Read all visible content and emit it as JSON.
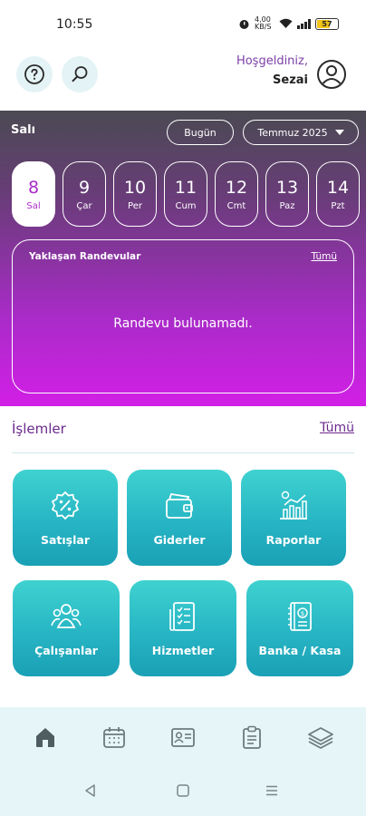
{
  "status": {
    "time": "10:55",
    "net": "4,00 KB/S",
    "battery": "57"
  },
  "header": {
    "welcome": "Hoşgeldiniz,",
    "user": "Sezai"
  },
  "hero": {
    "day_title": "Salı",
    "today_label": "Bugün",
    "month_label": "Temmuz 2025",
    "days": [
      {
        "num": "8",
        "name": "Sal",
        "active": true
      },
      {
        "num": "9",
        "name": "Çar"
      },
      {
        "num": "10",
        "name": "Per"
      },
      {
        "num": "11",
        "name": "Cum"
      },
      {
        "num": "12",
        "name": "Cmt"
      },
      {
        "num": "13",
        "name": "Paz"
      },
      {
        "num": "14",
        "name": "Pzt"
      }
    ],
    "appointments": {
      "title": "Yaklaşan Randevular",
      "all": "Tümü",
      "empty": "Randevu bulunamadı."
    }
  },
  "operations": {
    "title": "İşlemler",
    "all": "Tümü",
    "tiles": [
      {
        "label": "Satışlar",
        "icon": "discount-badge-icon"
      },
      {
        "label": "Giderler",
        "icon": "wallet-icon"
      },
      {
        "label": "Raporlar",
        "icon": "chart-report-icon"
      },
      {
        "label": "Çalışanlar",
        "icon": "team-icon"
      },
      {
        "label": "Hizmetler",
        "icon": "checklist-icon"
      },
      {
        "label": "Banka / Kasa",
        "icon": "ledger-icon"
      }
    ]
  },
  "nav": [
    "home-icon",
    "calendar-icon",
    "contact-card-icon",
    "clipboard-icon",
    "layers-icon"
  ],
  "colors": {
    "accent": "#a92bc8",
    "teal": "#27b5c4",
    "title_purple": "#6b2a8c",
    "nav_bg": "#e6f5f7"
  }
}
